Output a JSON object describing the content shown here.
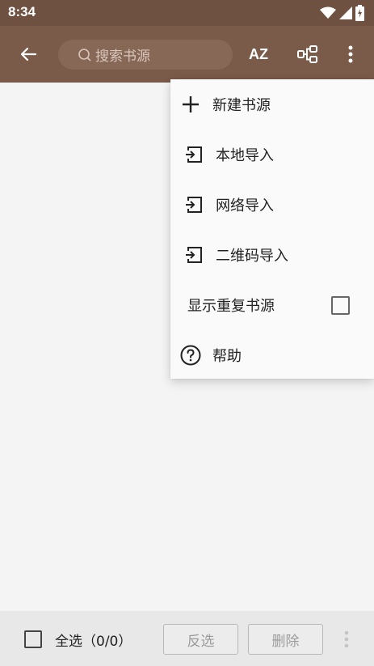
{
  "status": {
    "time": "8:34"
  },
  "appbar": {
    "search_placeholder": "搜索书源",
    "sort_label": "AZ",
    "colors": {
      "appbar": "#7a5a49",
      "statusbar": "#6f5142"
    }
  },
  "menu": {
    "items": [
      {
        "label": "新建书源",
        "icon": "plus-icon"
      },
      {
        "label": "本地导入",
        "icon": "import-icon"
      },
      {
        "label": "网络导入",
        "icon": "import-icon"
      },
      {
        "label": "二维码导入",
        "icon": "import-icon"
      },
      {
        "label": "显示重复书源",
        "checked": false
      },
      {
        "label": "帮助",
        "icon": "help-icon"
      }
    ]
  },
  "bottom": {
    "select_all_label": "全选（0/0）",
    "invert_label": "反选",
    "delete_label": "删除"
  }
}
